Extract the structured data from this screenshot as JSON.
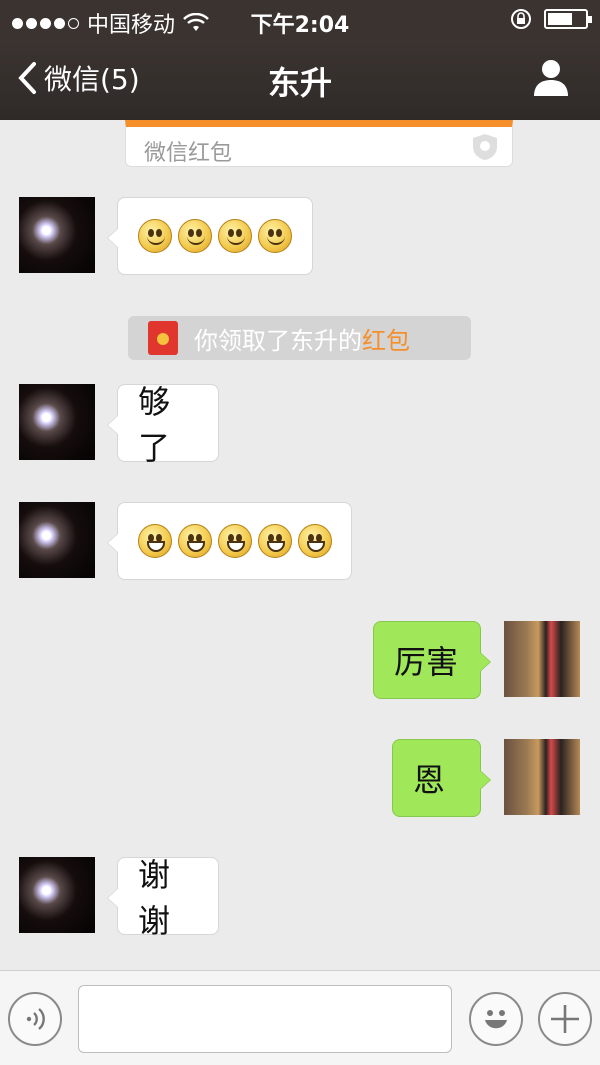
{
  "status_bar": {
    "carrier": "中国移动",
    "time": "下午2:04"
  },
  "nav": {
    "back_label": "微信(5)",
    "title": "东升"
  },
  "redpacket_card": {
    "label": "微信红包"
  },
  "messages": [
    {
      "id": "m1",
      "side": "left",
      "type": "emoji",
      "emojis": [
        "smile",
        "smile",
        "smile",
        "smile"
      ]
    },
    {
      "id": "notice",
      "type": "system",
      "text": "你领取了东升的",
      "link": "红包"
    },
    {
      "id": "m2",
      "side": "left",
      "type": "text",
      "text": "够了"
    },
    {
      "id": "m3",
      "side": "left",
      "type": "emoji",
      "emojis": [
        "grin",
        "grin",
        "grin",
        "grin",
        "grin"
      ]
    },
    {
      "id": "m4",
      "side": "right",
      "type": "text",
      "text": "厉害"
    },
    {
      "id": "m5",
      "side": "right",
      "type": "text",
      "text": "恩"
    },
    {
      "id": "m6",
      "side": "left",
      "type": "text",
      "text": "谢谢"
    }
  ],
  "colors": {
    "accent": "#f48f2a",
    "my_bubble": "#a0e75a",
    "header_bg": "#3a3330"
  },
  "input_bar": {
    "voice_icon": "voice-icon",
    "emoji_icon": "emoji-icon",
    "plus_icon": "plus-icon"
  }
}
